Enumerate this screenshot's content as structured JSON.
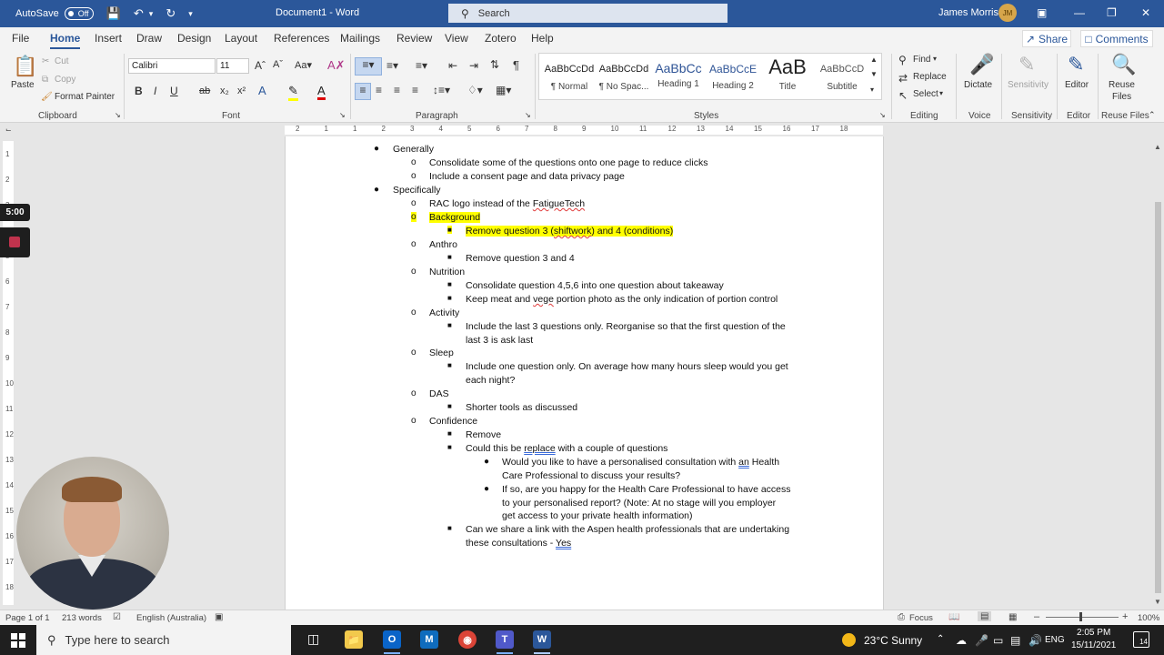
{
  "titlebar": {
    "autosave_label": "AutoSave",
    "autosave_state": "Off",
    "doc_title": "Document1 - Word",
    "search_placeholder": "Search",
    "user_name": "James Morris",
    "user_initials": "JM"
  },
  "menu": {
    "tabs": [
      "File",
      "Home",
      "Insert",
      "Draw",
      "Design",
      "Layout",
      "References",
      "Mailings",
      "Review",
      "View",
      "Zotero",
      "Help"
    ],
    "share": "Share",
    "comments": "Comments"
  },
  "ribbon": {
    "clipboard": {
      "paste": "Paste",
      "cut": "Cut",
      "copy": "Copy",
      "format_painter": "Format Painter",
      "label": "Clipboard"
    },
    "font": {
      "name": "Calibri",
      "size": "11",
      "label": "Font"
    },
    "paragraph": {
      "label": "Paragraph"
    },
    "styles": {
      "label": "Styles",
      "items": [
        {
          "preview": "AaBbCcDd",
          "name": "¶ Normal"
        },
        {
          "preview": "AaBbCcDd",
          "name": "¶ No Spac..."
        },
        {
          "preview": "AaBbCc",
          "name": "Heading 1"
        },
        {
          "preview": "AaBbCcE",
          "name": "Heading 2"
        },
        {
          "preview": "AaB",
          "name": "Title"
        },
        {
          "preview": "AaBbCcD",
          "name": "Subtitle"
        }
      ]
    },
    "editing": {
      "find": "Find",
      "replace": "Replace",
      "select": "Select",
      "label": "Editing"
    },
    "voice": {
      "dictate": "Dictate",
      "label": "Voice"
    },
    "sensitivity": {
      "button": "Sensitivity",
      "label": "Sensitivity"
    },
    "editor": {
      "button": "Editor",
      "label": "Editor"
    },
    "reuse": {
      "button_line1": "Reuse",
      "button_line2": "Files",
      "label": "Reuse Files"
    }
  },
  "ruler": {
    "h_ticks": [
      "2",
      "1",
      "1",
      "2",
      "3",
      "4",
      "5",
      "6",
      "7",
      "8",
      "9",
      "10",
      "11",
      "12",
      "13",
      "14",
      "15",
      "16",
      "17",
      "18"
    ],
    "v_ticks": [
      "1",
      "2",
      "3",
      "4",
      "5",
      "6",
      "7",
      "8",
      "9",
      "10",
      "11",
      "12",
      "13",
      "14",
      "15",
      "16",
      "17",
      "18"
    ]
  },
  "document": {
    "lines": {
      "l1": "Generally",
      "l2": "Consolidate some of the questions onto one page to reduce clicks",
      "l3": "Include a consent page and data privacy page",
      "l4": "Specifically",
      "l5a": "RAC logo instead of the ",
      "l5b": "FatigueTech",
      "l6": "Background",
      "l7a": "Remove question 3 (",
      "l7b": "shiftwork",
      "l7c": ") and 4 (conditions)",
      "l8": "Anthro",
      "l9": "Remove question 3 and 4",
      "l10": "Nutrition",
      "l11": "Consolidate question 4,5,6 into one question about takeaway",
      "l12a": "Keep meat and ",
      "l12b": "vege",
      "l12c": " portion photo as the only indication of portion control",
      "l13": "Activity",
      "l14": "Include the last 3 questions only. Reorganise so that the first question of the",
      "l14b": "last 3 is ask last",
      "l15": "Sleep",
      "l16": "Include one question only. On average how many hours sleep would you get",
      "l16b": "each night?",
      "l17": "DAS",
      "l18": "Shorter tools as discussed",
      "l19": "Confidence",
      "l20": "Remove",
      "l21a": "Could this be ",
      "l21b": "replace",
      "l21c": " with a couple of questions",
      "l22a": "Would you like to have a personalised consultation with ",
      "l22b": "an",
      "l22c": " Health",
      "l22d": "Care Professional to discuss your results?",
      "l23": "If so, are you happy for the Health Care Professional to have access",
      "l23b": "to your personalised report? (Note: At no stage will you employer",
      "l23c": "get access to your private health information)",
      "l24": "Can we share a link with the Aspen health professionals that are undertaking",
      "l24b": "these consultations - ",
      "l24c": "Yes"
    }
  },
  "recording": {
    "timer": "5:00"
  },
  "statusbar": {
    "page": "Page 1 of 1",
    "words": "213 words",
    "language": "English (Australia)",
    "focus": "Focus",
    "zoom": "100%"
  },
  "taskbar": {
    "search_placeholder": "Type here to search",
    "weather": "23°C  Sunny",
    "lang": "ENG",
    "time": "2:05 PM",
    "date": "15/11/2021",
    "notif_count": "14"
  },
  "colors": {
    "word_blue": "#2b579a",
    "highlight": "#ffff00",
    "taskbar": "#1f1f1f"
  }
}
